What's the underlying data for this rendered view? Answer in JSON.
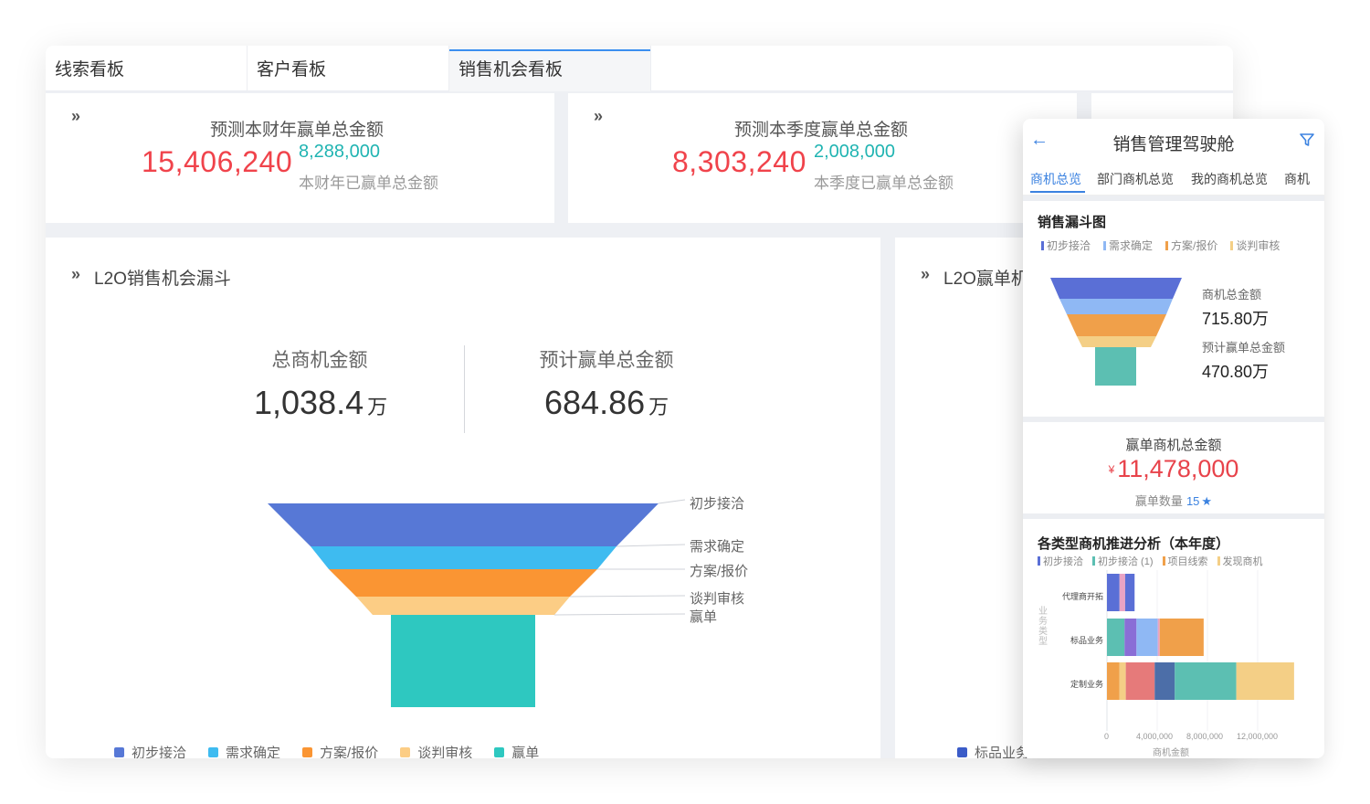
{
  "desktop": {
    "tabs": [
      {
        "label": "线索看板",
        "active": false
      },
      {
        "label": "客户看板",
        "active": false
      },
      {
        "label": "销售机会看板",
        "active": true
      }
    ],
    "kpi_year": {
      "title": "预测本财年赢单总金额",
      "value": "15,406,240",
      "sub_value": "8,288,000",
      "sub_label": "本财年已赢单总金额"
    },
    "kpi_quarter": {
      "title": "预测本季度赢单总金额",
      "value": "8,303,240",
      "sub_value": "2,008,000",
      "sub_label": "本季度已赢单总金额"
    },
    "funnel_panel": {
      "title": "L2O销售机会漏斗",
      "total_label": "总商机金额",
      "total_value": "1,038.4",
      "total_unit": "万",
      "forecast_label": "预计赢单总金额",
      "forecast_value": "684.86",
      "forecast_unit": "万",
      "stage_labels": [
        "初步接洽",
        "需求确定",
        "方案/报价",
        "谈判审核",
        "赢单"
      ],
      "legend": [
        {
          "label": "初步接洽",
          "color": "#5778d6"
        },
        {
          "label": "需求确定",
          "color": "#3ebbf0"
        },
        {
          "label": "方案/报价",
          "color": "#fa9533"
        },
        {
          "label": "谈判审核",
          "color": "#fccd85"
        },
        {
          "label": "赢单",
          "color": "#2ec8c0"
        }
      ]
    },
    "right_panel": {
      "title": "L2O赢单机",
      "legend_label": "标品业务",
      "legend_color": "#3b5cc8"
    }
  },
  "mobile": {
    "title": "销售管理驾驶舱",
    "tabs": [
      {
        "label": "商机总览",
        "active": true
      },
      {
        "label": "部门商机总览",
        "active": false
      },
      {
        "label": "我的商机总览",
        "active": false
      },
      {
        "label": "商机",
        "active": false
      }
    ],
    "funnel": {
      "title": "销售漏斗图",
      "legend": [
        {
          "label": "初步接洽",
          "color": "#5a6fd6"
        },
        {
          "label": "需求确定",
          "color": "#8fb8f4"
        },
        {
          "label": "方案/报价",
          "color": "#f0a04a"
        },
        {
          "label": "谈判审核",
          "color": "#f4cf86"
        }
      ],
      "total_label": "商机总金额",
      "total_value": "715.80万",
      "forecast_label": "预计赢单总金额",
      "forecast_value": "470.80万"
    },
    "win": {
      "label": "赢单商机总金额",
      "currency": "¥",
      "value": "11,478,000",
      "count_label": "赢单数量",
      "count": "15"
    },
    "bar_section": {
      "title": "各类型商机推进分析（本年度）",
      "legend": [
        {
          "label": "初步接洽",
          "color": "#5a6fd6"
        },
        {
          "label": "初步接洽 (1)",
          "color": "#5cbfb2"
        },
        {
          "label": "项目线索",
          "color": "#f0a04a"
        },
        {
          "label": "发现商机",
          "color": "#f4cf86"
        }
      ]
    }
  },
  "chart_data": [
    {
      "type": "bar",
      "orientation": "horizontal",
      "stacked": true,
      "title": "",
      "categories": [
        "代理商开拓",
        "标品业务",
        "定制业务"
      ],
      "ylabel": "业务类型",
      "xlabel": "商机金额",
      "xlim": [
        0,
        16000000
      ],
      "x_ticks": [
        0,
        4000000,
        8000000,
        12000000
      ],
      "x_tick_labels": [
        "0",
        "4,000,000",
        "8,000,000",
        "12,000,000"
      ],
      "segments": [
        {
          "category": "代理商开拓",
          "parts": [
            {
              "value": 1000000,
              "color": "#5a6fd6"
            },
            {
              "value": 450000,
              "color": "#e9a3c4"
            },
            {
              "value": 750000,
              "color": "#5a6fd6"
            }
          ]
        },
        {
          "category": "标品业务",
          "parts": [
            {
              "value": 1400000,
              "color": "#5cbfb2"
            },
            {
              "value": 950000,
              "color": "#8a6ed6"
            },
            {
              "value": 1700000,
              "color": "#8fb8f4"
            },
            {
              "value": 150000,
              "color": "#e9a3c4"
            },
            {
              "value": 3500000,
              "color": "#f0a04a"
            }
          ]
        },
        {
          "category": "定制业务",
          "parts": [
            {
              "value": 1000000,
              "color": "#f0a04a"
            },
            {
              "value": 500000,
              "color": "#f4cf86"
            },
            {
              "value": 2300000,
              "color": "#e67a7a"
            },
            {
              "value": 1600000,
              "color": "#4c6ea8"
            },
            {
              "value": 4900000,
              "color": "#5cbfb2"
            },
            {
              "value": 4600000,
              "color": "#f4cf86"
            }
          ]
        }
      ]
    }
  ]
}
